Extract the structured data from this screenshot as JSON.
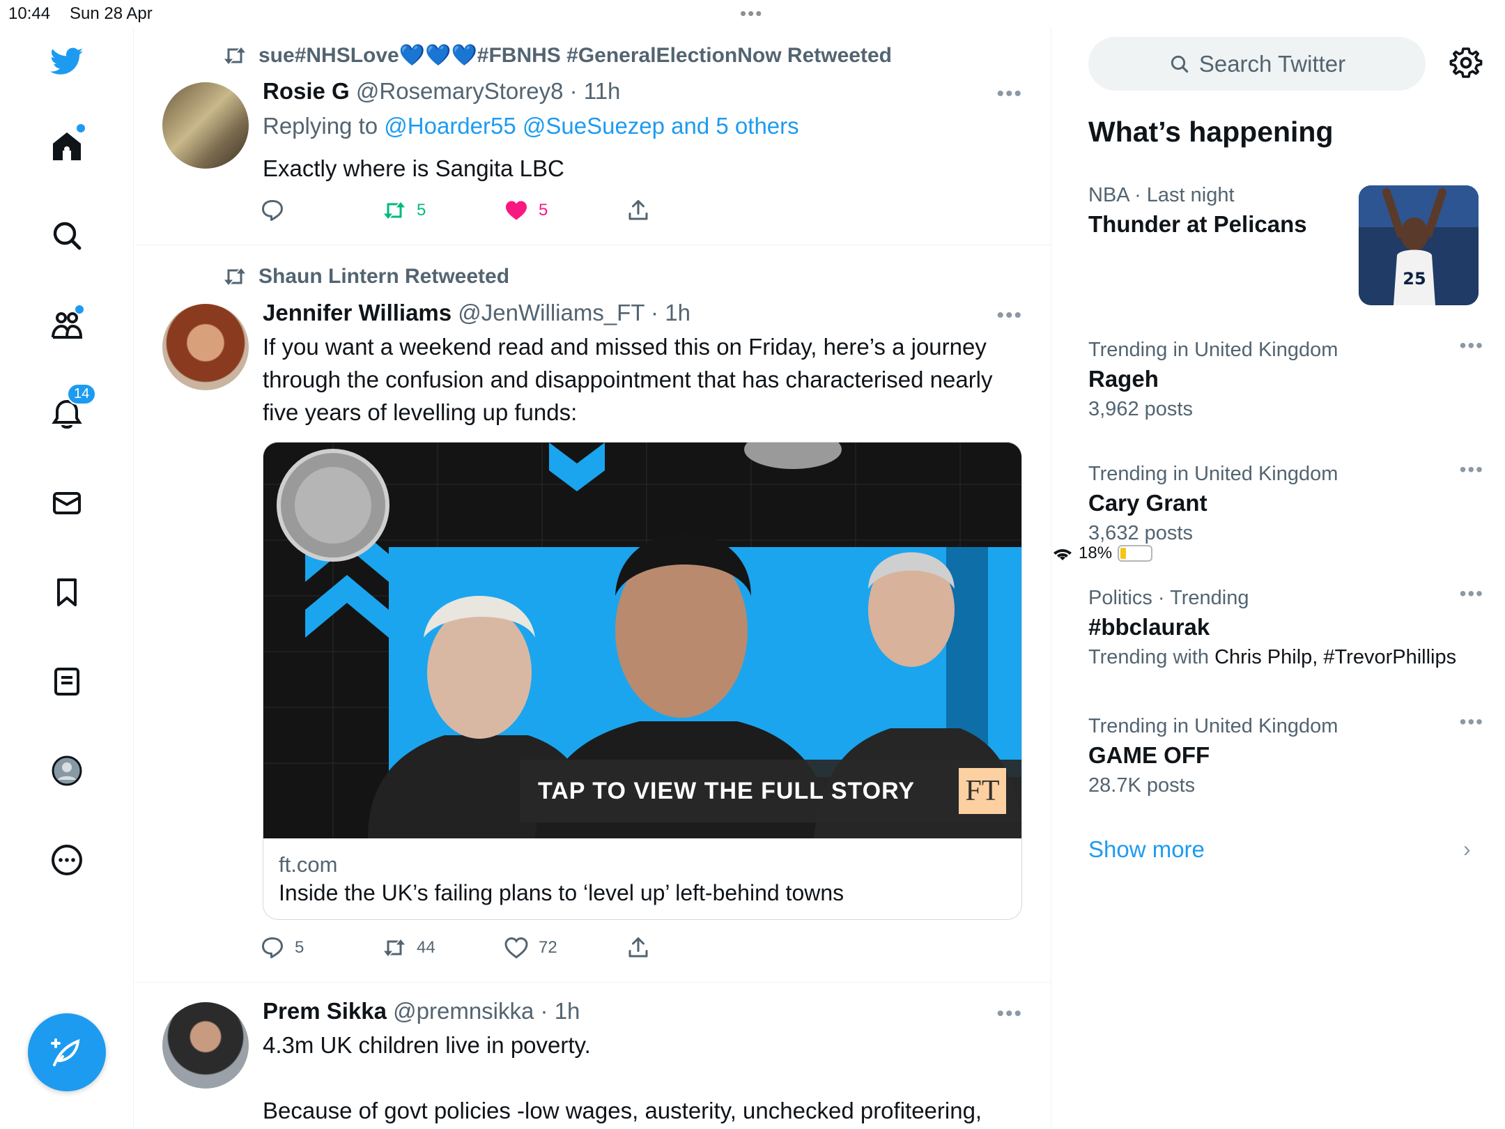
{
  "status": {
    "time": "10:44",
    "date": "Sun 28 Apr",
    "battery": "18%"
  },
  "nav": {
    "notifications_badge": "14"
  },
  "tweets": [
    {
      "retweeted_by": "sue#NHSLove💙💙💙#FBNHS #GeneralElectionNow Retweeted",
      "name": "Rosie G",
      "handle_time": "@RosemaryStorey8 · 11h",
      "replying_prefix": "Replying to",
      "replying_to": "@Hoarder55 @SueSuezep and 5 others",
      "text": "Exactly where is Sangita LBC",
      "reply_count": "",
      "retweet_count": "5",
      "like_count": "5"
    },
    {
      "retweeted_by": "Shaun Lintern Retweeted",
      "name": "Jennifer Williams",
      "handle_time": "@JenWilliams_FT · 1h",
      "text": "If you want a weekend read and missed this on Friday, here’s a journey through the confusion and disappointment that has characterised nearly five years of levelling up funds:",
      "card": {
        "banner": "TAP TO VIEW THE FULL STORY",
        "logo": "FT",
        "domain": "ft.com",
        "title": "Inside the UK’s failing plans to ‘level up’ left-behind towns"
      },
      "reply_count": "5",
      "retweet_count": "44",
      "like_count": "72"
    },
    {
      "name": "Prem Sikka",
      "handle_time": "@premnsikka · 1h",
      "text_line1": "4.3m UK children live in poverty.",
      "text_line2": "Because of govt policies -low wages, austerity, unchecked profiteering,"
    }
  ],
  "sidebar": {
    "search_placeholder": "Search Twitter",
    "heading": "What’s happening",
    "trends": [
      {
        "meta": "NBA · Last night",
        "title": "Thunder at Pelicans",
        "sub": ""
      },
      {
        "meta": "Trending in United Kingdom",
        "title": "Rageh",
        "sub": "3,962 posts"
      },
      {
        "meta": "Trending in United Kingdom",
        "title": "Cary Grant",
        "sub": "3,632 posts"
      },
      {
        "meta": "Politics · Trending",
        "title": "#bbclaurak",
        "sub_prefix": "Trending with",
        "sub_names": "Chris Philp, #TrevorPhillips"
      },
      {
        "meta": "Trending in United Kingdom",
        "title": "GAME OFF",
        "sub": "28.7K posts"
      }
    ],
    "show_more": "Show more"
  },
  "colors": {
    "accent": "#1d9bf0",
    "like": "#f91880",
    "retweet": "#00ba7c",
    "muted": "#536471"
  }
}
